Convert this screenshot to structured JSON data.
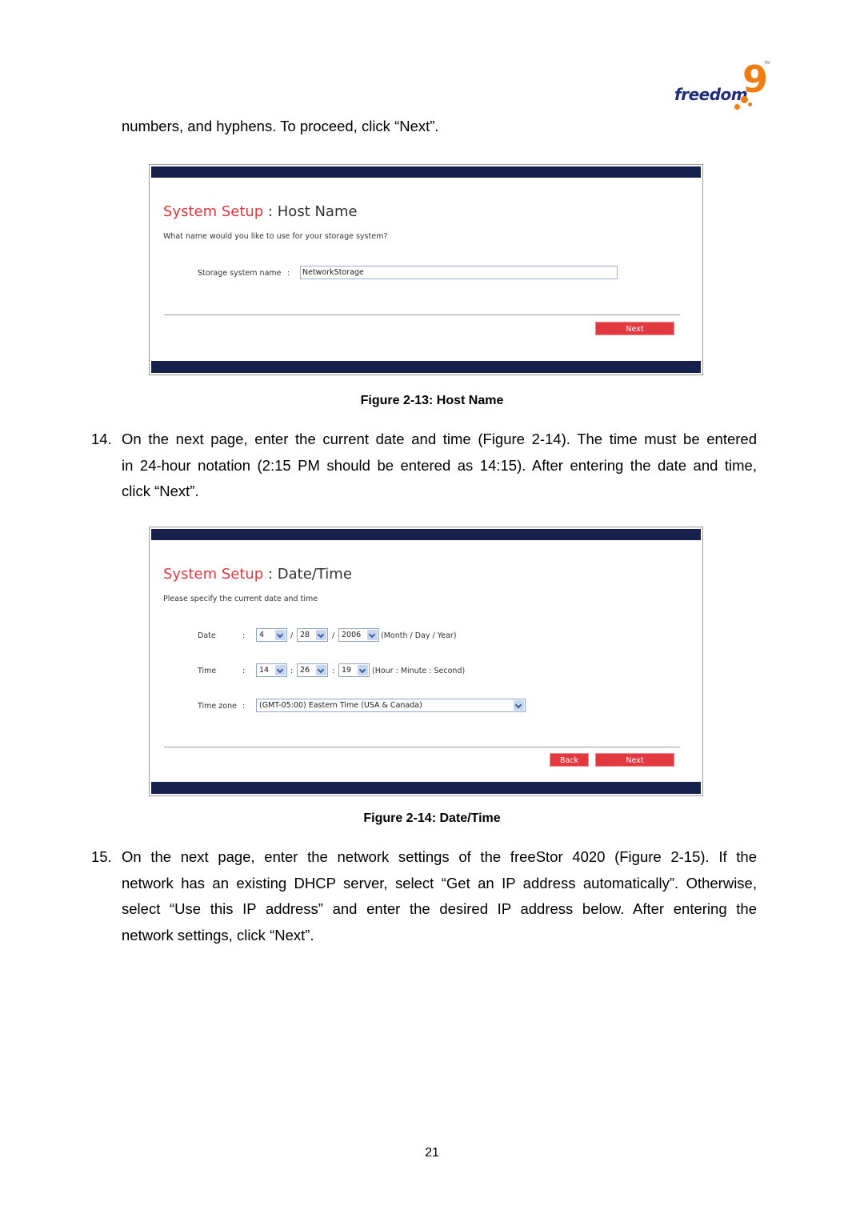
{
  "brand": {
    "logo_word": "freedom",
    "logo_mark": "9",
    "logo_tm": "TM",
    "colors": {
      "navy": "#1f2d7a",
      "orange": "#f07c12"
    }
  },
  "intro_text": "numbers, and hyphens. To proceed, click “Next”.",
  "figure13": {
    "title_red": "System Setup",
    "title_sep": " : ",
    "title_rest": "Host Name",
    "question": "What name would you like to use for your storage system?",
    "field_label": "Storage system name",
    "field_colon": ":",
    "field_value": "NetworkStorage",
    "next_label": "Next",
    "caption": "Figure 2-13: Host Name"
  },
  "step14": {
    "number": "14.",
    "lines": [
      "On the next page, enter the current date and time (Figure 2-14). The time must be entered",
      "in 24-hour notation (2:15 PM should be entered as 14:15). After entering the date and time,",
      "click “Next”."
    ]
  },
  "figure14": {
    "title_red": "System Setup",
    "title_sep": " : ",
    "title_rest": "Date/Time",
    "prompt": "Please specify the current date and time",
    "date": {
      "label": "Date",
      "colon": ":",
      "month": "4",
      "day": "28",
      "year": "2006",
      "separator": "/",
      "hint": "(Month / Day / Year)"
    },
    "time": {
      "label": "Time",
      "colon": ":",
      "hour": "14",
      "minute": "26",
      "second": "19",
      "separator": ":",
      "hint": "(Hour : Minute : Second)"
    },
    "timezone": {
      "label": "Time zone",
      "colon": ":",
      "value": "(GMT-05:00) Eastern Time (USA & Canada)"
    },
    "back_label": "Back",
    "next_label": "Next",
    "caption": "Figure 2-14: Date/Time"
  },
  "step15": {
    "number": "15.",
    "lines": [
      "On the next page, enter the network settings of the freeStor 4020 (Figure 2-15). If the",
      "network has an existing DHCP server, select “Get an IP address automatically”. Otherwise,",
      "select “Use this IP address” and enter the desired IP address below. After entering the",
      "network settings, click “Next”."
    ]
  },
  "page_number": "21",
  "ui_colors": {
    "header_bar": "#16214d",
    "accent_red": "#e2383f"
  }
}
